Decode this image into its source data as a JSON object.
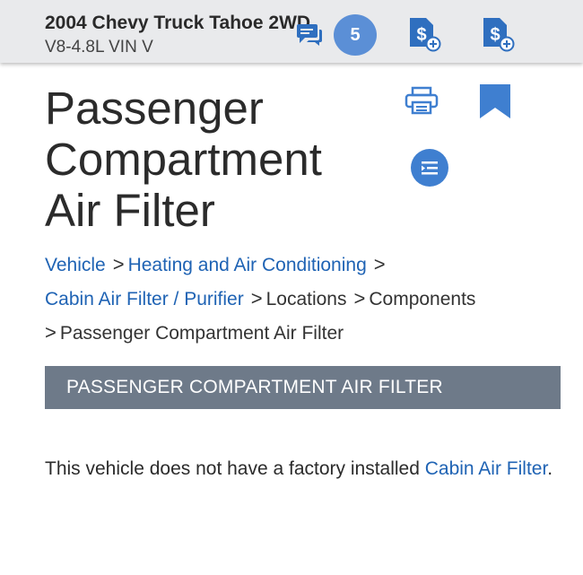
{
  "header": {
    "vehicle_title": "2004 Chevy Truck Tahoe 2WD",
    "vehicle_subtitle": "V8-4.8L VIN V",
    "notification_count": "5"
  },
  "page": {
    "title_lines": [
      "Passenger",
      "Compartment",
      "Air Filter"
    ]
  },
  "breadcrumb": {
    "items": [
      "Vehicle",
      "Heating and Air Conditioning",
      "Cabin Air Filter / Purifier",
      "Locations",
      "Components",
      "Passenger Compartment Air Filter"
    ],
    "separator": ">"
  },
  "section": {
    "heading": "PASSENGER COMPARTMENT AIR FILTER"
  },
  "content": {
    "text_before": "This vehicle does not have a factory installed ",
    "link_text": "Cabin Air Filter",
    "text_after": "."
  },
  "colors": {
    "accent": "#2f6fbf",
    "badge": "#5b8fd6",
    "link": "#1f63b4",
    "section_bar": "#6e7a89"
  },
  "icons": [
    "chat-icon",
    "dollar-add-icon",
    "printer-icon",
    "bookmark-icon",
    "outline-icon"
  ]
}
